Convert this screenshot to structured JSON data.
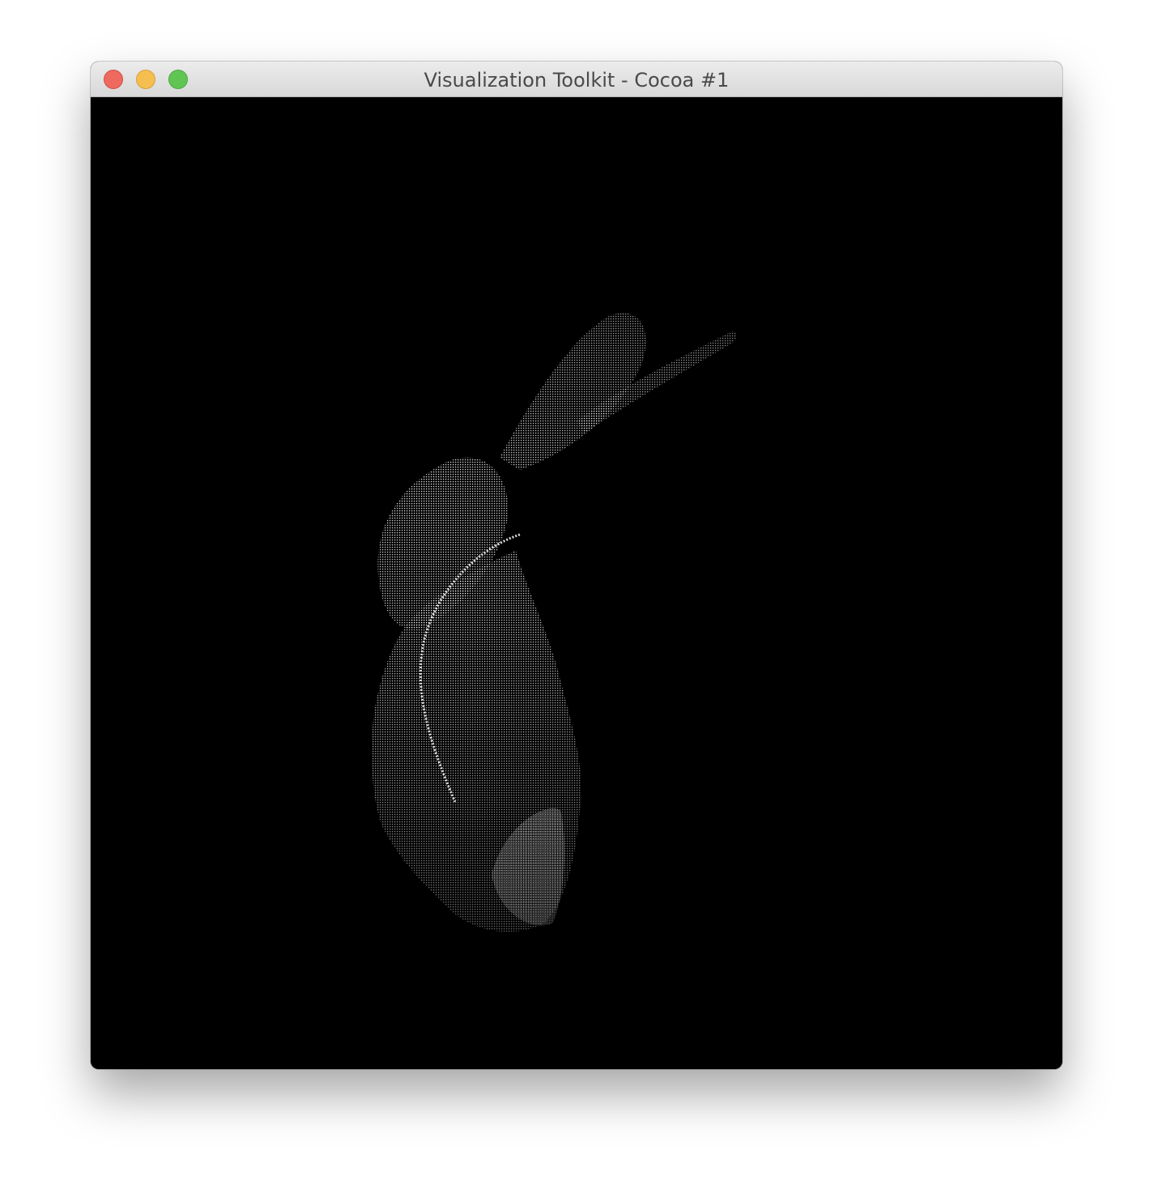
{
  "window": {
    "title": "Visualization Toolkit - Cocoa #1"
  },
  "colors": {
    "background": "#000000",
    "points": "#ffffff",
    "close": "#ee6a5e",
    "minimize": "#f5bf4f",
    "zoom": "#61c554"
  },
  "viewport": {
    "content": "point-cloud-bunny"
  }
}
